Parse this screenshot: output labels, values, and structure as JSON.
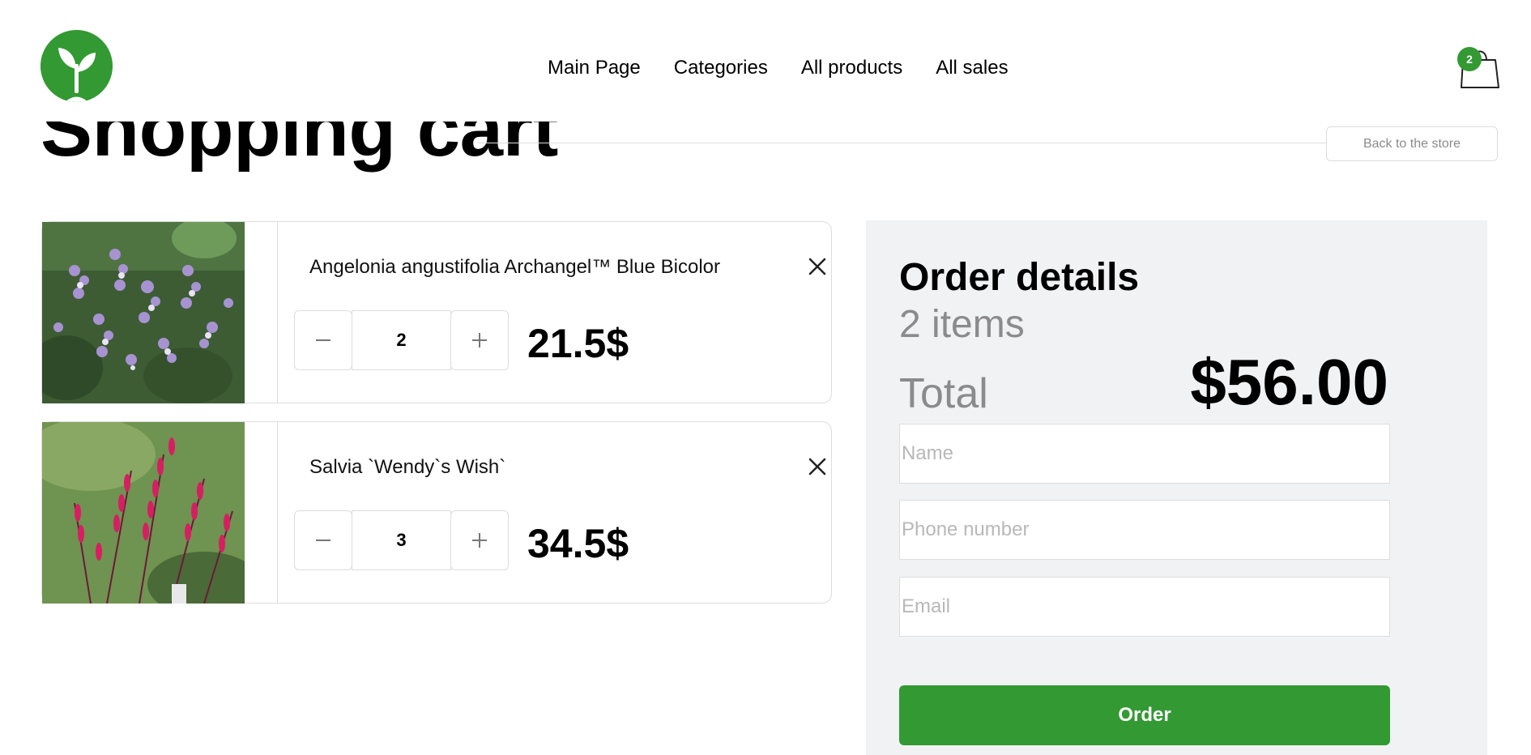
{
  "header": {
    "logo": "sprout-logo-icon",
    "nav": [
      {
        "label": "Main Page"
      },
      {
        "label": "Categories"
      },
      {
        "label": "All products"
      },
      {
        "label": "All sales"
      }
    ],
    "cart": {
      "icon": "shopping-bag-icon",
      "badge_count": "2"
    }
  },
  "page": {
    "title": "Shopping cart",
    "back_label": "Back to the store"
  },
  "cart_items": [
    {
      "name": "Angelonia angustifolia Archangel™ Blue Bicolor",
      "quantity": "2",
      "price": "21.5$",
      "image": "angelonia-flowers-photo"
    },
    {
      "name": "Salvia `Wendy`s Wish`",
      "quantity": "3",
      "price": "34.5$",
      "image": "salvia-flowers-photo"
    }
  ],
  "order": {
    "title": "Order details",
    "items_count": "2 items",
    "total_label": "Total",
    "total_value": "$56.00",
    "name_placeholder": "Name",
    "phone_placeholder": "Phone number",
    "email_placeholder": "Email",
    "submit_label": "Order"
  },
  "colors": {
    "accent": "#339933",
    "panel_bg": "#f1f2f4",
    "muted_text": "#8b8b8b",
    "border": "#dddddd"
  }
}
